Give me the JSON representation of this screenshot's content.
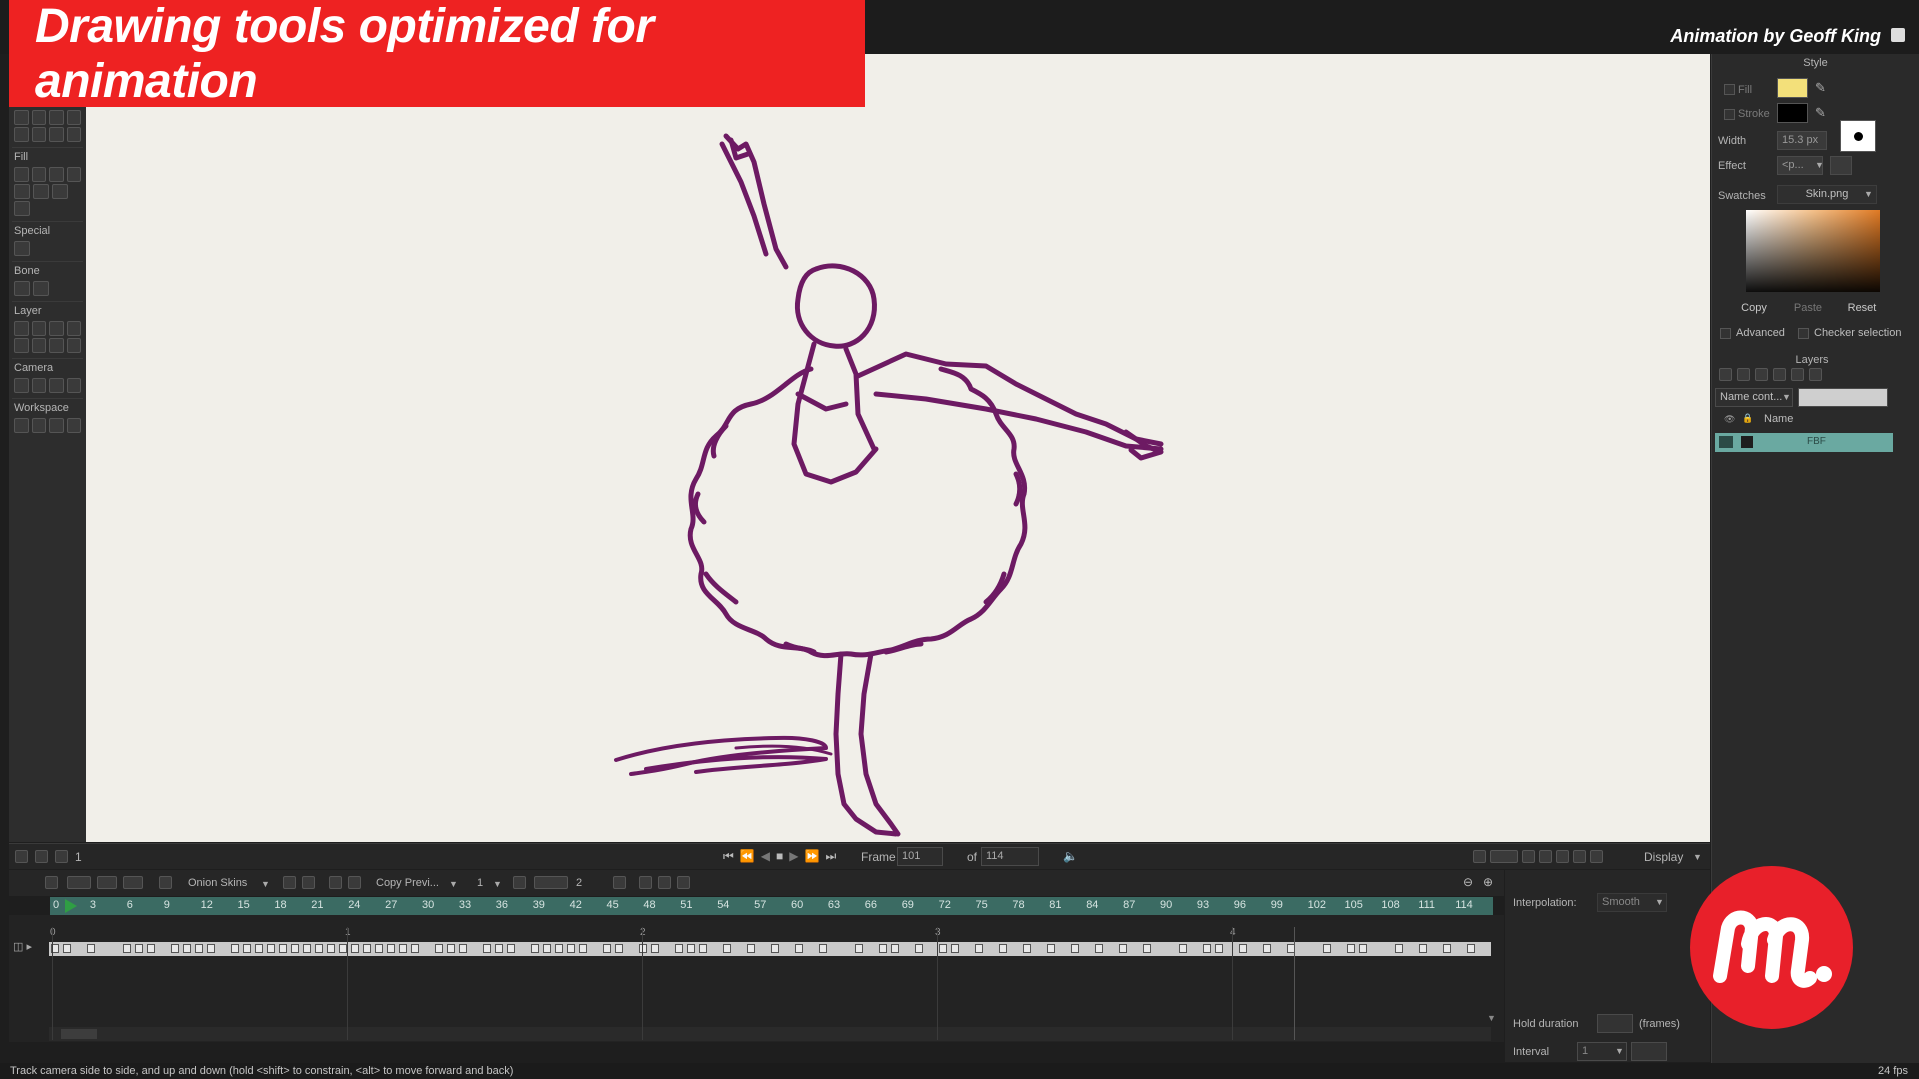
{
  "banner": {
    "title": "Drawing tools optimized for animation"
  },
  "credit": "Animation by Geoff King",
  "toolbox": {
    "sections": [
      "Fill",
      "Special",
      "Bone",
      "Layer",
      "Camera",
      "Workspace"
    ]
  },
  "style_panel": {
    "title": "Style",
    "fill_label": "Fill",
    "fill_color": "#f3e07a",
    "stroke_label": "Stroke",
    "stroke_color": "#000000",
    "width_label": "Width",
    "width_value": "15.3 px",
    "effect_label": "Effect",
    "effect_value": "<p...",
    "swatches_label": "Swatches",
    "swatches_value": "Skin.png",
    "copy": "Copy",
    "paste": "Paste",
    "reset": "Reset",
    "advanced": "Advanced",
    "checker": "Checker selection"
  },
  "layers_panel": {
    "title": "Layers",
    "filter": "Name cont...",
    "col_name": "Name",
    "layer_name": "FBF"
  },
  "transport": {
    "frame_label": "Frame",
    "frame_value": "101",
    "of_label": "of",
    "total": "114",
    "display": "Display",
    "left_num": "1"
  },
  "timeline": {
    "onion": "Onion Skins",
    "copy_prev": "Copy Previ...",
    "num1": "1",
    "num2": "2",
    "ruler_ticks": [
      "0",
      "3",
      "6",
      "9",
      "12",
      "15",
      "18",
      "21",
      "24",
      "27",
      "30",
      "33",
      "36",
      "39",
      "42",
      "45",
      "48",
      "51",
      "54",
      "57",
      "60",
      "63",
      "66",
      "69",
      "72",
      "75",
      "78",
      "81",
      "84",
      "87",
      "90",
      "93",
      "96",
      "99",
      "102",
      "105",
      "108",
      "111",
      "114"
    ],
    "second_ticks": [
      "0",
      "1",
      "2",
      "3",
      "4"
    ],
    "interpolation_label": "Interpolation:",
    "interpolation_value": "Smooth",
    "hold_label": "Hold duration",
    "hold_unit": "(frames)",
    "interval_label": "Interval",
    "interval_value": "1"
  },
  "status": {
    "hint": "Track camera side to side, and up and down (hold <shift> to constrain, <alt> to move forward and back)",
    "fps": "24 fps"
  },
  "colors": {
    "accent_red": "#ee2222",
    "ruler_teal": "#3b6b63",
    "layer_teal": "#6aa9a1",
    "stroke_purple": "#6d1a63"
  }
}
